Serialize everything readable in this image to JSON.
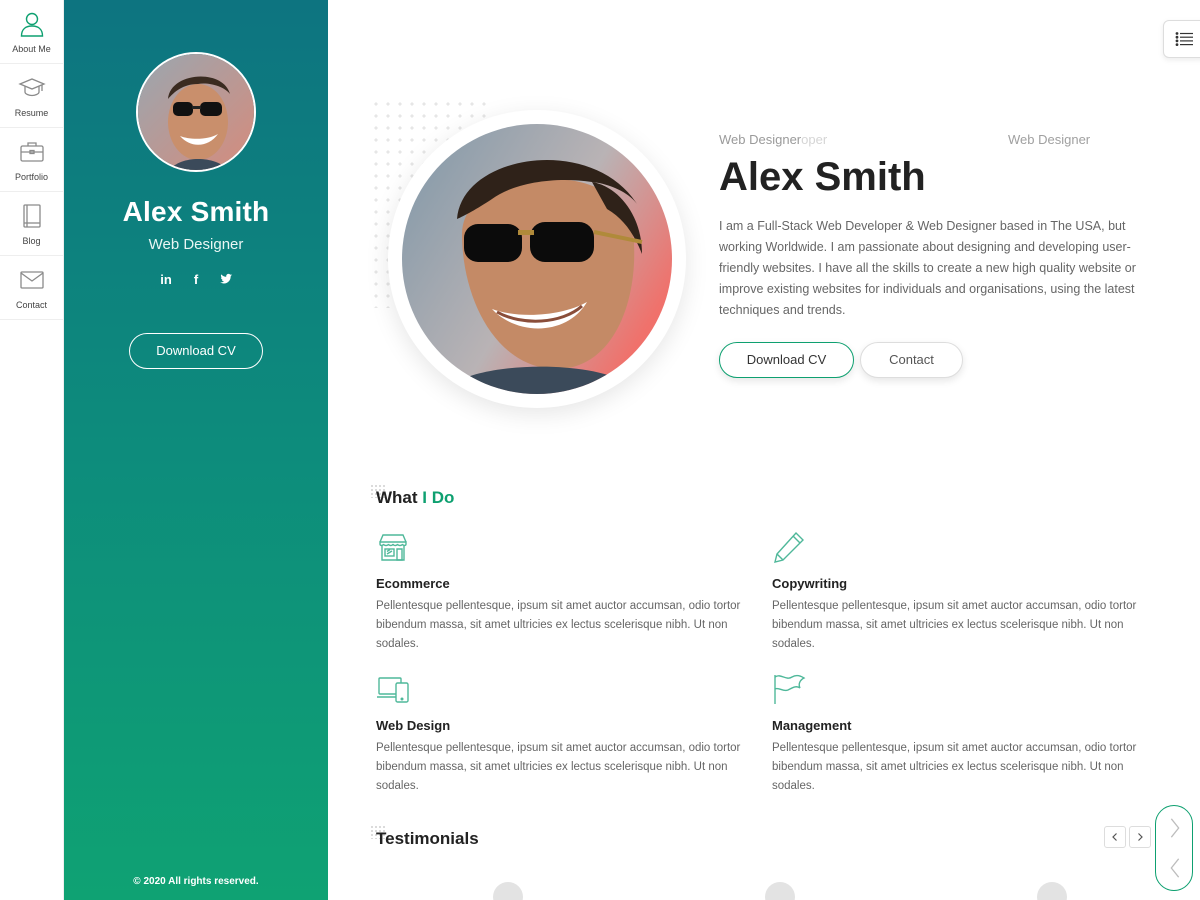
{
  "nav": {
    "items": [
      {
        "label": "About Me",
        "icon": "user-icon"
      },
      {
        "label": "Resume",
        "icon": "graduation-cap-icon"
      },
      {
        "label": "Portfolio",
        "icon": "briefcase-icon"
      },
      {
        "label": "Blog",
        "icon": "book-icon"
      },
      {
        "label": "Contact",
        "icon": "envelope-icon"
      }
    ]
  },
  "profile": {
    "name": "Alex Smith",
    "role": "Web Designer",
    "socials": [
      "in",
      "f",
      "t"
    ],
    "download_label": "Download CV",
    "copyright": "© 2020 All rights reserved."
  },
  "hero": {
    "role_prefix": "Web Designer",
    "role_ghost": "oper",
    "role_secondary": "Web Designer",
    "name": "Alex Smith",
    "bio": "I am a Full-Stack Web Developer & Web Designer based in The USA, but working Worldwide. I am passionate about designing and developing user-friendly websites. I have all the skills to create a new high quality website or improve existing websites for individuals and organisations, using the latest techniques and trends.",
    "download_label": "Download CV",
    "contact_label": "Contact"
  },
  "services": {
    "title_main": "What",
    "title_accent": "I Do",
    "items": [
      {
        "title": "Ecommerce",
        "icon": "store-icon",
        "text": "Pellentesque pellentesque, ipsum sit amet auctor accumsan, odio tortor bibendum massa, sit amet ultricies ex lectus scelerisque nibh. Ut non sodales."
      },
      {
        "title": "Copywriting",
        "icon": "pencil-icon",
        "text": "Pellentesque pellentesque, ipsum sit amet auctor accumsan, odio tortor bibendum massa, sit amet ultricies ex lectus scelerisque nibh. Ut non sodales."
      },
      {
        "title": "Web Design",
        "icon": "devices-icon",
        "text": "Pellentesque pellentesque, ipsum sit amet auctor accumsan, odio tortor bibendum massa, sit amet ultricies ex lectus scelerisque nibh. Ut non sodales."
      },
      {
        "title": "Management",
        "icon": "flag-icon",
        "text": "Pellentesque pellentesque, ipsum sit amet auctor accumsan, odio tortor bibendum massa, sit amet ultricies ex lectus scelerisque nibh. Ut non sodales."
      }
    ]
  },
  "testimonials": {
    "title": "Testimonials"
  },
  "colors": {
    "accent": "#0ea070",
    "sidebar_top": "#0d7480",
    "sidebar_bottom": "#0fa273"
  }
}
